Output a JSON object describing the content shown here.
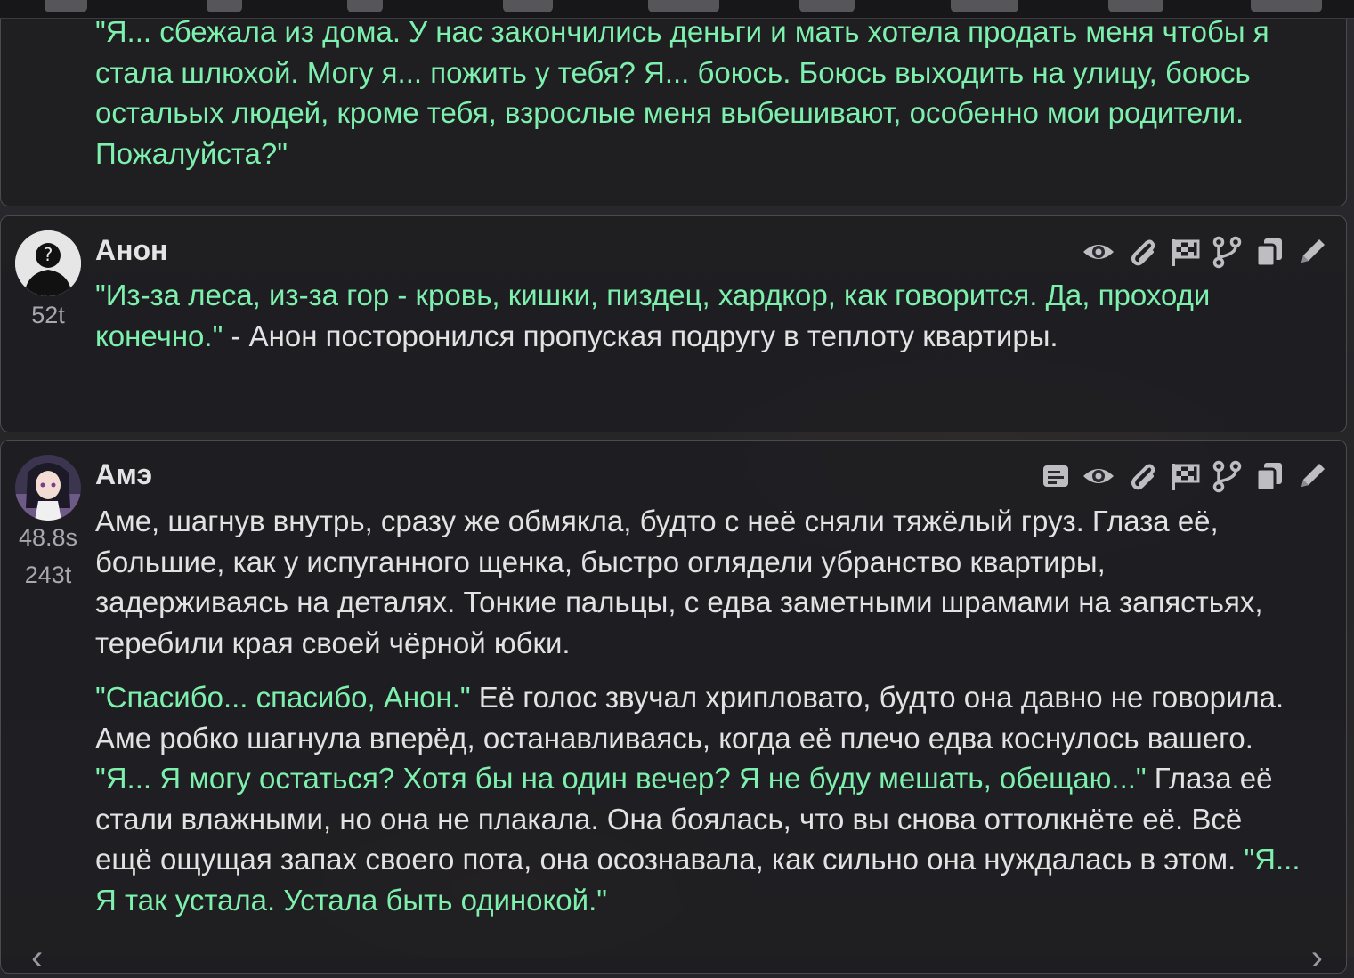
{
  "colors": {
    "quote": "#7ef0ad",
    "text": "#e2e2e2",
    "muted": "#a8a8ae",
    "panel": "#1e1e21"
  },
  "messages": [
    {
      "id": "prev",
      "paragraphs": [
        [
          {
            "q": true,
            "t": "\"Я... сбежала из дома. У нас закончились деньги и мать хотела продать меня чтобы я стала шлюхой. Могу я... пожить у тебя? Я... боюсь. Боюсь выходить на улицу, боюсь остальых людей, кроме тебя, взрослые меня выбешивают, особенно мои родители. Пожалуйста?\""
          }
        ]
      ]
    },
    {
      "id": "anon",
      "name": "Анон",
      "tokens": "52t",
      "paragraphs": [
        [
          {
            "q": true,
            "t": "\"Из-за леса, из-за гор - кровь, кишки, пиздец, хардкор, как говорится. Да, проходи конечно.\""
          },
          {
            "q": false,
            "t": " - Анон посторонился пропуская подругу в теплоту квартиры."
          }
        ]
      ]
    },
    {
      "id": "ame",
      "name": "Амэ",
      "time": "48.8s",
      "tokens": "243t",
      "paragraphs": [
        [
          {
            "q": false,
            "t": "Аме, шагнув внутрь, сразу же обмякла, будто с неё сняли тяжёлый груз. Глаза её, большие, как у испуганного щенка, быстро оглядели убранство квартиры, задерживаясь на деталях. Тонкие пальцы, с едва заметными шрамами на запястьях, теребили края своей чёрной юбки."
          }
        ],
        [
          {
            "q": true,
            "t": "\"Спасибо... спасибо, Анон.\""
          },
          {
            "q": false,
            "t": " Её голос звучал хрипловато, будто она давно не говорила. Аме робко шагнула вперёд, останавливаясь, когда её плечо едва коснулось вашего. "
          },
          {
            "q": true,
            "t": "\"Я... Я могу остаться? Хотя бы на один вечер? Я не буду мешать, обещаю...\""
          },
          {
            "q": false,
            "t": " Глаза её стали влажными, но она не плакала. Она боялась, что вы снова оттолкнёте её. Всё ещё ощущая запах своего пота, она осознавала, как сильно она нуждалась в этом. "
          },
          {
            "q": true,
            "t": "\"Я... Я так устала. Устала быть одинокой.\""
          }
        ]
      ]
    }
  ],
  "icons": {
    "anon": [
      "eye-icon",
      "paperclip-icon",
      "flag-checkered-icon",
      "branch-icon",
      "copy-icon",
      "pencil-icon"
    ],
    "ame": [
      "prompt-icon",
      "eye-icon",
      "paperclip-icon",
      "flag-checkered-icon",
      "branch-icon",
      "copy-icon",
      "pencil-icon"
    ]
  },
  "nav": {
    "left": "‹",
    "right": "›"
  }
}
